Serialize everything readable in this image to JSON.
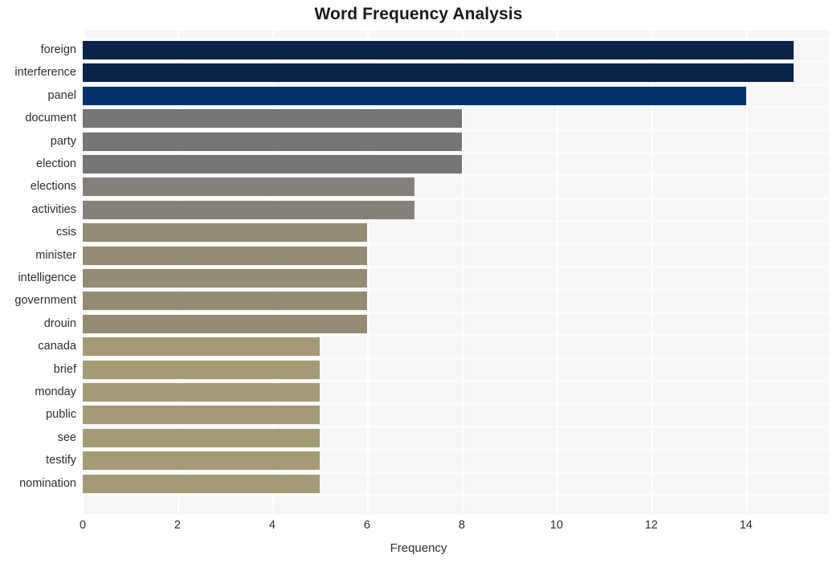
{
  "chart_data": {
    "type": "bar",
    "orientation": "horizontal",
    "title": "Word Frequency Analysis",
    "xlabel": "Frequency",
    "ylabel": "",
    "categories": [
      "foreign",
      "interference",
      "panel",
      "document",
      "party",
      "election",
      "elections",
      "activities",
      "csis",
      "minister",
      "intelligence",
      "government",
      "drouin",
      "canada",
      "brief",
      "monday",
      "public",
      "see",
      "testify",
      "nomination"
    ],
    "values": [
      15,
      15,
      14,
      8,
      8,
      8,
      7,
      7,
      6,
      6,
      6,
      6,
      6,
      5,
      5,
      5,
      5,
      5,
      5,
      5
    ],
    "bar_colors": [
      "#0a2348",
      "#0a2348",
      "#06326e",
      "#757575",
      "#757575",
      "#757575",
      "#83817a",
      "#83817a",
      "#948b72",
      "#948b72",
      "#948b72",
      "#948b72",
      "#948b72",
      "#a49b75",
      "#a49b75",
      "#a49b75",
      "#a49b75",
      "#a49b75",
      "#a49b75",
      "#a49b75"
    ],
    "xlim": [
      0,
      15.75
    ],
    "xticks": [
      0,
      2,
      4,
      6,
      8,
      10,
      12,
      14
    ],
    "xticklabels": [
      "0",
      "2",
      "4",
      "6",
      "8",
      "10",
      "12",
      "14"
    ],
    "grid": true,
    "grid_color": "#ffffff",
    "plot_background": "#f6f6f7",
    "figure_background": "#ffffff",
    "legend": null
  }
}
